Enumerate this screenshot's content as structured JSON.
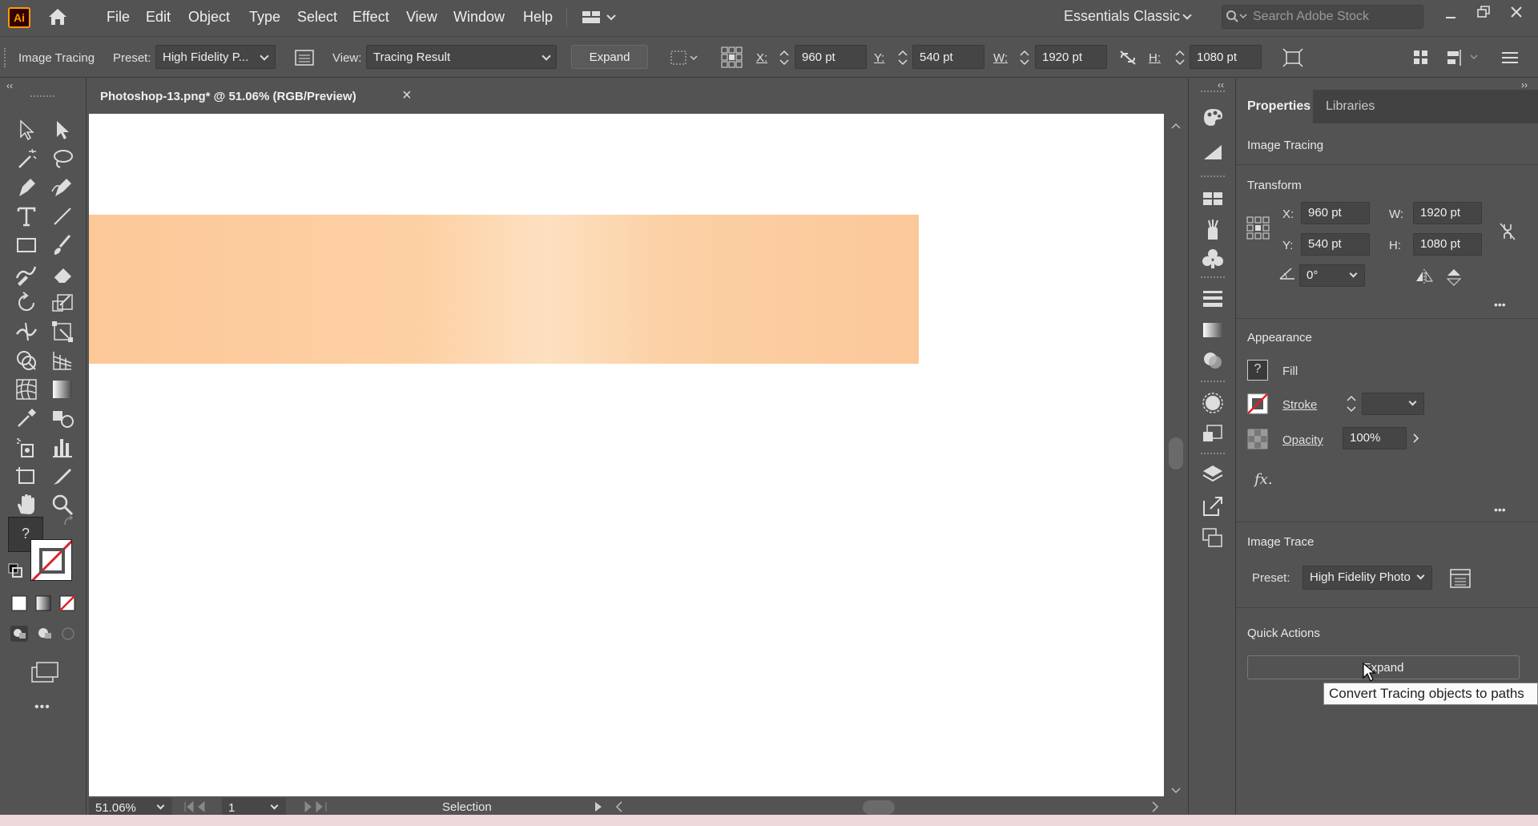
{
  "app": {
    "logo": "Ai",
    "menus": [
      "File",
      "Edit",
      "Object",
      "Type",
      "Select",
      "Effect",
      "View",
      "Window",
      "Help"
    ],
    "workspace": "Essentials Classic",
    "stock_search_placeholder": "Search Adobe Stock"
  },
  "control_bar": {
    "mode_label": "Image Tracing",
    "preset_label": "Preset:",
    "preset_value": "High Fidelity P...",
    "view_label": "View:",
    "view_value": "Tracing Result",
    "expand_label": "Expand",
    "x_label": "X:",
    "x_value": "960 pt",
    "y_label": "Y:",
    "y_value": "540 pt",
    "w_label": "W:",
    "w_value": "1920 pt",
    "h_label": "H:",
    "h_value": "1080 pt"
  },
  "document": {
    "tab_title": "Photoshop-13.png* @ 51.06% (RGB/Preview)",
    "close_glyph": "×",
    "image_colors": [
      "#fcc898",
      "#fde0c0",
      "#fbc89a"
    ]
  },
  "status_bar": {
    "zoom": "51.06%",
    "artboard": "1",
    "tool": "Selection"
  },
  "toolbar": {
    "fill_unknown_glyph": "?",
    "more_glyph": "•••"
  },
  "properties": {
    "tab_properties": "Properties",
    "tab_libraries": "Libraries",
    "selection_type": "Image Tracing",
    "transform": {
      "title": "Transform",
      "x_label": "X:",
      "x_value": "960 pt",
      "y_label": "Y:",
      "y_value": "540 pt",
      "w_label": "W:",
      "w_value": "1920 pt",
      "h_label": "H:",
      "h_value": "1080 pt",
      "angle_value": "0°"
    },
    "appearance": {
      "title": "Appearance",
      "fill_label": "Fill",
      "fill_glyph": "?",
      "stroke_label": "Stroke",
      "opacity_label": "Opacity",
      "opacity_value": "100%",
      "fx_label": "fx."
    },
    "image_trace": {
      "title": "Image Trace",
      "preset_label": "Preset:",
      "preset_value": "High Fidelity Photo"
    },
    "quick_actions": {
      "title": "Quick Actions",
      "expand_label": "Expand",
      "tooltip": "Convert Tracing objects to paths"
    }
  },
  "colors": {
    "panel_bg": "#535353",
    "canvas_bg": "#ffffff",
    "stroke_none": "#e0202a",
    "ai_orange": "#ff9a00"
  }
}
